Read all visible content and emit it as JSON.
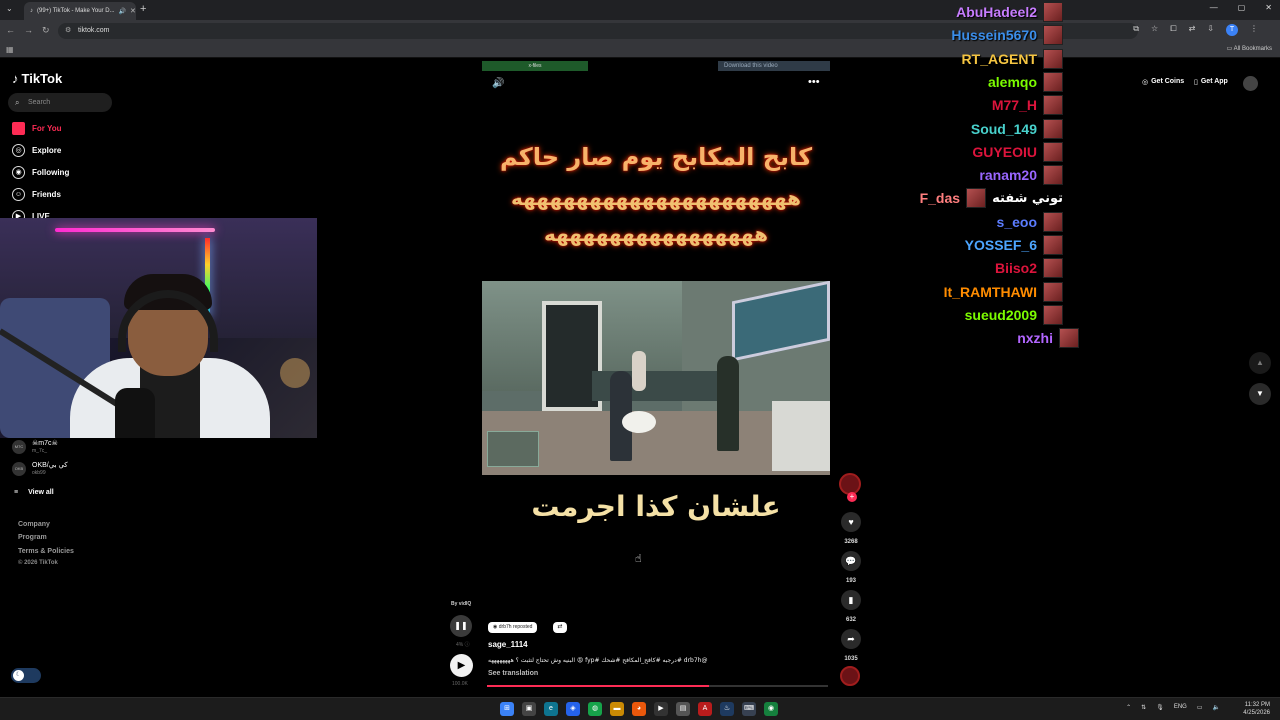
{
  "browser": {
    "tab_title": "(99+) TikTok - Make Your D...",
    "url": "tiktok.com",
    "all_bookmarks": "All Bookmarks"
  },
  "tiktok": {
    "logo": "TikTok",
    "search_placeholder": "Search",
    "menu": [
      {
        "label": "For You",
        "icon": "home-icon"
      },
      {
        "label": "Explore",
        "icon": "compass-icon"
      },
      {
        "label": "Following",
        "icon": "following-icon"
      },
      {
        "label": "Friends",
        "icon": "friends-icon"
      },
      {
        "label": "LIVE",
        "icon": "live-icon"
      }
    ],
    "following_accounts": [
      {
        "avatar": "M7C",
        "name": "☠m7c☠",
        "handle": "m_7c_"
      },
      {
        "avatar": "OKB",
        "name": "OKB/كي بي",
        "handle": "okb99"
      }
    ],
    "view_all": "View all",
    "footer": [
      "Company",
      "Program",
      "Terms & Policies"
    ],
    "copyright": "© 2026 TikTok",
    "get_coins": "Get Coins",
    "get_app": "Get App"
  },
  "video": {
    "top_left_bar": "x-files",
    "top_right_bar": "Download this video",
    "overlay_line1": "كابح المكابح يوم صار حاكم",
    "overlay_line2": "هههههههههههههههههههههه",
    "overlay_line3": "ههههههههههههههههه",
    "overlay_bottom": "علشان كذا اجرمت",
    "by_line": "By vidIQ",
    "reposted": "drb7h reposted",
    "author": "sage_1114",
    "caption": "@drb7h #درجبه #كافح_المكافح #شحك #fyp 😡 البنيه وش تحتاج لتثبت ؟ ههههههههه",
    "see_translation": "See translation",
    "meta1": "4% ⓘ",
    "meta2": "100.0K",
    "progress": 0.65
  },
  "actions": {
    "likes": "3268",
    "comments": "193",
    "saves": "632",
    "shares": "1035"
  },
  "chat": [
    {
      "name": "AbuHadeel2",
      "color": "#c77dff",
      "msg": ""
    },
    {
      "name": "Hussein5670",
      "color": "#3b8eea",
      "msg": ""
    },
    {
      "name": "RT_AGENT",
      "color": "#f5c542",
      "msg": ""
    },
    {
      "name": "alemqo",
      "color": "#7cfc00",
      "msg": ""
    },
    {
      "name": "M77_H",
      "color": "#dc143c",
      "msg": ""
    },
    {
      "name": "Soud_149",
      "color": "#48d1cc",
      "msg": ""
    },
    {
      "name": "GUYEOIU",
      "color": "#dc143c",
      "msg": ""
    },
    {
      "name": "ranam20",
      "color": "#9966ff",
      "msg": ""
    },
    {
      "name": "F_das",
      "color": "#ff7f7f",
      "msg": "توني شفته"
    },
    {
      "name": "s_eoo",
      "color": "#5b7cff",
      "msg": ""
    },
    {
      "name": "YOSSEF_6",
      "color": "#4da6ff",
      "msg": ""
    },
    {
      "name": "Biiso2",
      "color": "#dc143c",
      "msg": ""
    },
    {
      "name": "It_RAMTHAWI",
      "color": "#ff8c00",
      "msg": ""
    },
    {
      "name": "sueud2009",
      "color": "#7cfc00",
      "msg": ""
    },
    {
      "name": "nxzhi",
      "color": "#b266ff",
      "msg": ""
    }
  ],
  "taskbar": {
    "lang": "ENG",
    "time": "11:32 PM",
    "date": "4/25/2026"
  }
}
